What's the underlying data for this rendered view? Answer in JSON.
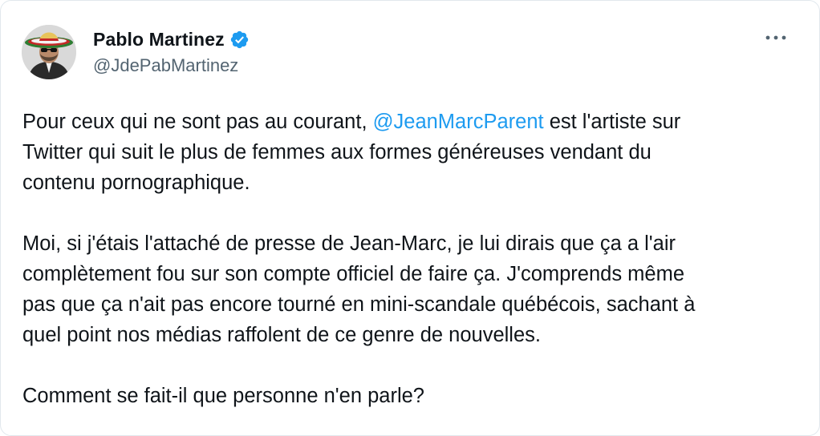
{
  "author": {
    "display_name": "Pablo Martinez",
    "handle": "@JdePabMartinez",
    "verified": true,
    "verified_color": "#1d9bf0"
  },
  "menu": {
    "icon": "more-horizontal-icon"
  },
  "tweet": {
    "p1_before": "Pour ceux qui ne sont pas au courant, ",
    "p1_mention": "@JeanMarcParent",
    "p1_after_line1": " est l'artiste sur",
    "p1_line2": "Twitter qui suit le plus de femmes aux formes généreuses vendant du",
    "p1_line3": "contenu pornographique.",
    "p2_line1": "Moi, si j'étais l'attaché de presse de Jean-Marc, je lui dirais que ça a l'air",
    "p2_line2": "complètement fou sur son compte officiel de faire ça. J'comprends même",
    "p2_line3": "pas que ça n'ait pas encore tourné en mini-scandale québécois, sachant à",
    "p2_line4": "quel point nos médias raffolent de ce genre de nouvelles.",
    "p3_line1": "Comment se fait-il que personne n'en parle?"
  },
  "colors": {
    "text": "#0f1419",
    "secondary": "#536471",
    "link": "#1d9bf0"
  }
}
